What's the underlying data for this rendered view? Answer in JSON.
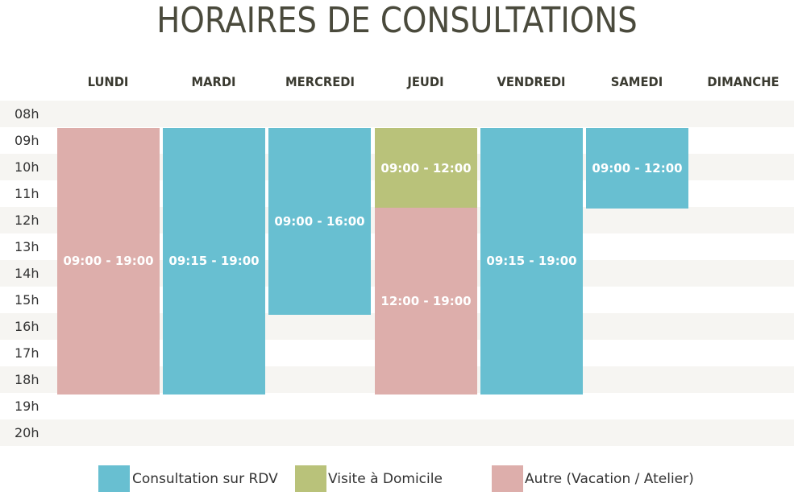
{
  "title": "HORAIRES DE CONSULTATIONS",
  "colors": {
    "consultation": "#68bfd1",
    "visite": "#b9c27a",
    "autre": "#ddaeab",
    "row_alt": "#f6f5f2"
  },
  "days": [
    "LUNDI",
    "MARDI",
    "MERCREDI",
    "JEUDI",
    "VENDREDI",
    "SAMEDI",
    "DIMANCHE"
  ],
  "hours": [
    "08h",
    "09h",
    "10h",
    "11h",
    "12h",
    "13h",
    "14h",
    "15h",
    "16h",
    "17h",
    "18h",
    "19h",
    "20h"
  ],
  "blocks": [
    {
      "day": "LUNDI",
      "label": "09:00 - 19:00",
      "type": "autre"
    },
    {
      "day": "MARDI",
      "label": "09:15 - 19:00",
      "type": "consultation"
    },
    {
      "day": "MERCREDI",
      "label": "09:00 - 16:00",
      "type": "consultation"
    },
    {
      "day": "JEUDI",
      "label": "09:00 - 12:00",
      "type": "visite"
    },
    {
      "day": "JEUDI",
      "label": "12:00 - 19:00",
      "type": "autre"
    },
    {
      "day": "VENDREDI",
      "label": "09:15 - 19:00",
      "type": "consultation"
    },
    {
      "day": "SAMEDI",
      "label": "09:00 - 12:00",
      "type": "consultation"
    }
  ],
  "legend": [
    {
      "label": "Consultation sur RDV",
      "type": "consultation"
    },
    {
      "label": "Visite à Domicile",
      "type": "visite"
    },
    {
      "label": "Autre (Vacation / Atelier)",
      "type": "autre"
    }
  ]
}
